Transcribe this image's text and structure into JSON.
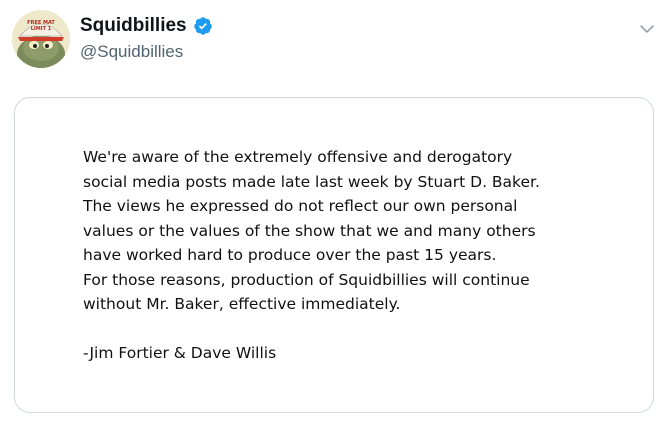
{
  "account": {
    "display_name": "Squidbillies",
    "handle": "@Squidbillies",
    "verified": true,
    "avatar_text_line1": "FREE MAT",
    "avatar_text_line2": "LIMIT 1"
  },
  "icons": {
    "verified": "verified-badge-icon",
    "more": "chevron-down-icon"
  },
  "colors": {
    "verified_blue": "#1d9bf0",
    "card_border": "#cfd9de",
    "handle_gray": "#536471"
  },
  "statement": {
    "lines": [
      "We're aware of the extremely offensive and derogatory",
      "social media posts made late last week by Stuart D. Baker.",
      "The views he expressed do not reflect our own personal",
      "values or the values of the show that we and many others",
      "have worked hard to produce over the past 15 years.",
      "For those reasons, production of Squidbillies will continue",
      "without Mr. Baker, effective immediately."
    ],
    "signature": "-Jim Fortier & Dave Willis"
  }
}
